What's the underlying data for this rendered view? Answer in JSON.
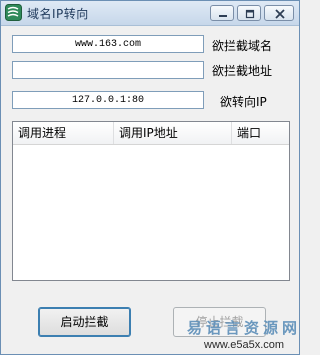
{
  "window": {
    "title": "域名IP转向"
  },
  "form": {
    "domain_value": "www.163.com",
    "domain_label": "欲拦截域名",
    "address_value": "",
    "address_label": "欲拦截地址",
    "redirect_ip_value": "127.0.0.1:80",
    "redirect_ip_label": "欲转向IP"
  },
  "table": {
    "columns": [
      "调用进程",
      "调用IP地址",
      "端口"
    ],
    "rows": []
  },
  "buttons": {
    "start_label": "启动拦截",
    "stop_label": "停止拦截"
  },
  "watermark": {
    "site_name": "易语言资源网",
    "url": "www.e5a5x.com"
  },
  "colors": {
    "accent": "#3c7fb1",
    "titlebar": "#c7d7ea",
    "watermark": "#5d8fb9"
  }
}
